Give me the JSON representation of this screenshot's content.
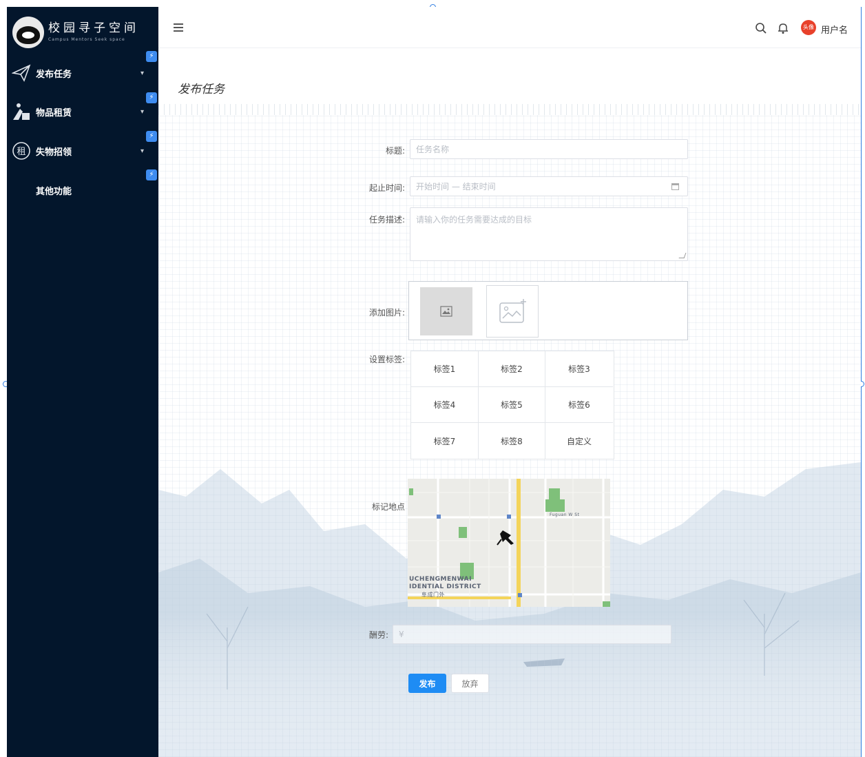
{
  "app": {
    "logo_title": "校园寻子空间",
    "logo_subtitle": "Campus Mentors Seek space"
  },
  "sidebar": {
    "items": [
      {
        "label": "发布任务",
        "icon": "paper-plane-icon",
        "has_submenu": true
      },
      {
        "label": "物品租赁",
        "icon": "person-box-icon",
        "has_submenu": true
      },
      {
        "label": "失物招领",
        "icon": "stamp-icon",
        "has_submenu": true
      },
      {
        "label": "其他功能",
        "icon": "",
        "has_submenu": false
      }
    ]
  },
  "header": {
    "avatar_text": "头像",
    "username": "用户名"
  },
  "page": {
    "title": "发布任务"
  },
  "form": {
    "title": {
      "label": "标题:",
      "placeholder": "任务名称"
    },
    "time": {
      "label": "起止时间:",
      "placeholder": "开始时间 — 结束时间"
    },
    "description": {
      "label": "任务描述:",
      "placeholder": "请输入你的任务需要达成的目标"
    },
    "images": {
      "label": "添加图片:"
    },
    "tags": {
      "label": "设置标签:",
      "items": [
        "标签1",
        "标签2",
        "标签3",
        "标签4",
        "标签5",
        "标签6",
        "标签7",
        "标签8",
        "自定义"
      ]
    },
    "location": {
      "label": "标记地点",
      "map_labels": [
        "UCHENGMENWAI",
        "IDENTIAL DISTRICT",
        "阜成门外",
        "Fuguan W St"
      ]
    },
    "reward": {
      "label": "酬劳:",
      "placeholder": "¥"
    },
    "submit_label": "发布",
    "cancel_label": "放弃"
  },
  "colors": {
    "sidebar_bg": "#03162c",
    "primary": "#1e8cf4",
    "accent_badge": "#3e8cf0",
    "avatar": "#e8412b"
  }
}
